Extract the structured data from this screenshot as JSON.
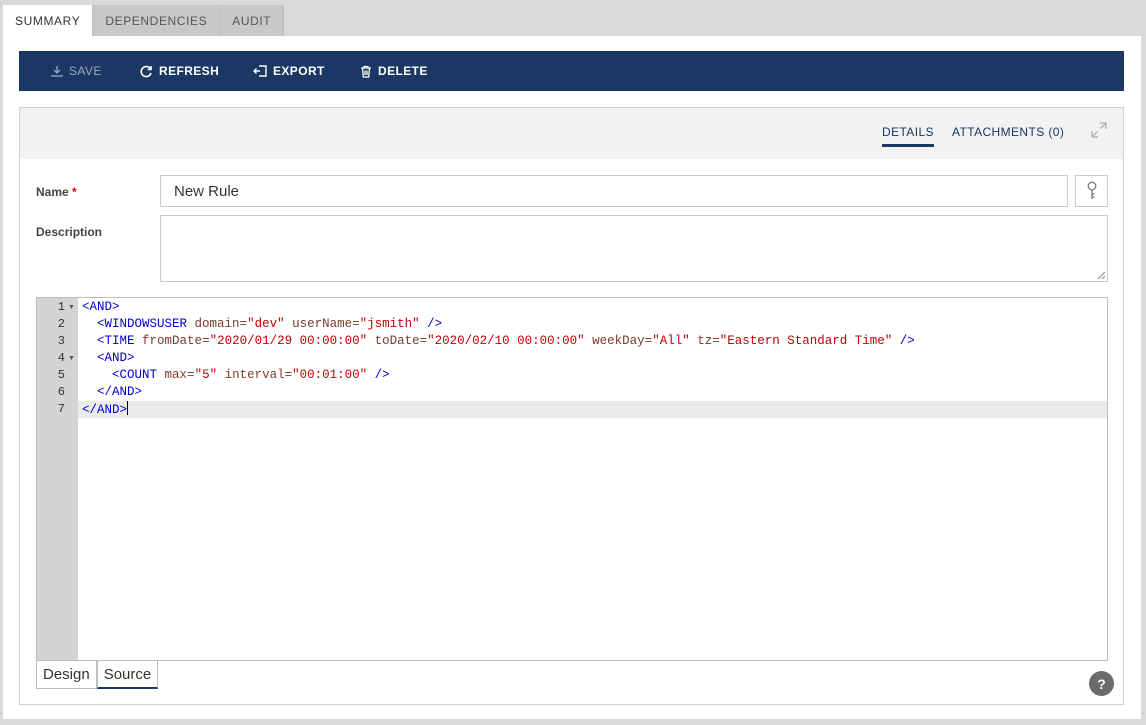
{
  "top_tabs": [
    "SUMMARY",
    "DEPENDENCIES",
    "AUDIT"
  ],
  "toolbar": {
    "save_label": "SAVE",
    "refresh_label": "REFRESH",
    "export_label": "EXPORT",
    "delete_label": "DELETE"
  },
  "panel_tabs": {
    "details": "DETAILS",
    "attachments": "ATTACHMENTS (0)"
  },
  "form": {
    "name_label": "Name",
    "required_mark": "*",
    "name_value": "New Rule",
    "description_label": "Description",
    "description_value": ""
  },
  "editor": {
    "line_numbers": [
      "1",
      "2",
      "3",
      "4",
      "5",
      "6",
      "7"
    ],
    "lines": [
      "<AND>",
      "  <WINDOWSUSER domain=\"dev\" userName=\"jsmith\" />",
      "  <TIME fromDate=\"2020/01/29 00:00:00\" toDate=\"2020/02/10 00:00:00\" weekDay=\"All\" tz=\"Eastern Standard Time\" />",
      "  <AND>",
      "    <COUNT max=\"5\" interval=\"00:01:00\" />",
      "  </AND>",
      "</AND>"
    ],
    "current_line": 7
  },
  "mode_tabs": {
    "design": "Design",
    "source": "Source"
  },
  "help_label": "?",
  "colors": {
    "toolbar_bg": "#1b3764",
    "tag": "#0000cc",
    "attribute": "#7a3b2b",
    "value": "#c00000"
  }
}
